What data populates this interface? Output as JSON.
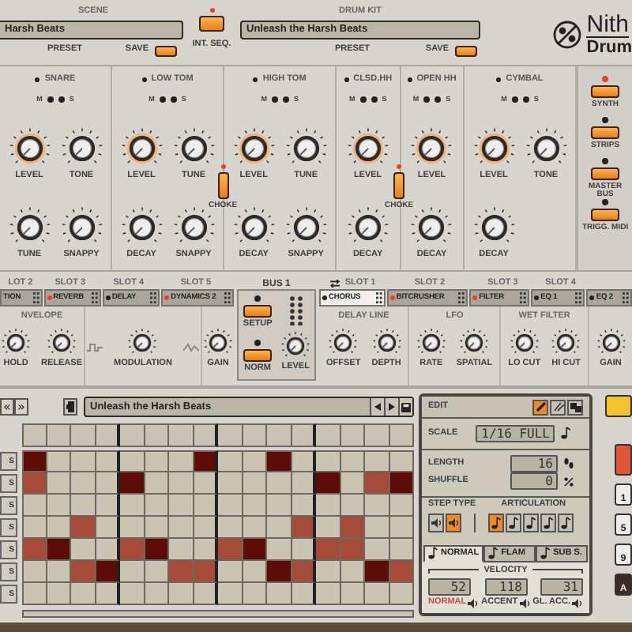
{
  "header": {
    "scene": {
      "label": "SCENE",
      "value": "Harsh Beats",
      "preset": "PRESET",
      "save": "SAVE"
    },
    "int_seq": {
      "label": "INT. SEQ.",
      "on": true
    },
    "drum_kit": {
      "label": "DRUM KIT",
      "value": "Unleash the Harsh Beats",
      "preset": "PRESET",
      "save": "SAVE"
    },
    "logo": {
      "title": "Nith",
      "subtitle": "Drum"
    }
  },
  "channels": [
    {
      "name": "SNARE",
      "mute": "M",
      "solo": "S",
      "knobs": [
        {
          "label": "LEVEL",
          "ring": true
        },
        {
          "label": "TONE",
          "ring": false
        },
        {
          "label": "TUNE",
          "ring": false
        },
        {
          "label": "SNAPPY",
          "ring": false
        }
      ]
    },
    {
      "name": "LOW TOM",
      "mute": "M",
      "solo": "S",
      "knobs": [
        {
          "label": "LEVEL",
          "ring": true
        },
        {
          "label": "TUNE",
          "ring": false
        },
        {
          "label": "DECAY",
          "ring": false
        },
        {
          "label": "SNAPPY",
          "ring": false
        }
      ],
      "choke": {
        "label": "CHOKE",
        "on": true
      }
    },
    {
      "name": "HIGH TOM",
      "mute": "M",
      "solo": "S",
      "knobs": [
        {
          "label": "LEVEL",
          "ring": true
        },
        {
          "label": "TUNE",
          "ring": false
        },
        {
          "label": "DECAY",
          "ring": false
        },
        {
          "label": "SNAPPY",
          "ring": false
        }
      ]
    },
    {
      "name": "CLSD.HH",
      "mute": "M",
      "solo": "S",
      "knobs": [
        {
          "label": "LEVEL",
          "ring": true
        },
        {
          "label": "DECAY",
          "ring": false
        }
      ],
      "choke": {
        "label": "CHOKE",
        "on": true
      }
    },
    {
      "name": "OPEN HH",
      "mute": "M",
      "solo": "S",
      "knobs": [
        {
          "label": "LEVEL",
          "ring": true
        },
        {
          "label": "DECAY",
          "ring": false
        }
      ]
    },
    {
      "name": "CYMBAL",
      "mute": "M",
      "solo": "S",
      "knobs": [
        {
          "label": "LEVEL",
          "ring": true
        },
        {
          "label": "TONE",
          "ring": false
        },
        {
          "label": "DECAY",
          "ring": false
        }
      ]
    }
  ],
  "mixer_buttons": [
    {
      "label": "SYNTH",
      "on": true
    },
    {
      "label": "STRIPS",
      "on": false
    },
    {
      "label": "MASTER BUS",
      "on": false
    },
    {
      "label": "TRIGG. MIDI",
      "on": false
    }
  ],
  "fx_left": {
    "slots": [
      "LOT 2",
      "SLOT 3",
      "SLOT 4",
      "SLOT 5"
    ],
    "tabs": [
      {
        "label": "TION",
        "selected": false
      },
      {
        "label": "REVERB",
        "on": true,
        "selected": false
      },
      {
        "label": "DELAY",
        "on": false,
        "selected": false
      },
      {
        "label": "DYNAMICS 2",
        "on": true,
        "selected": false
      }
    ],
    "sections": [
      {
        "title": "NVELOPE",
        "knobs": [
          "HOLD",
          "RELEASE"
        ]
      },
      {
        "kind": "modulation",
        "knobs": [
          "MODULATION"
        ]
      },
      {
        "knobs": [
          "GAIN"
        ]
      }
    ]
  },
  "bus": {
    "title": "BUS 1",
    "setup": "SETUP",
    "norm": "NORM",
    "knob": "LEVEL"
  },
  "fx_right": {
    "slots": [
      "SLOT 1",
      "SLOT 2",
      "SLOT 3",
      "SLOT 4"
    ],
    "tabs": [
      {
        "label": "CHORUS",
        "on": false,
        "selected": true
      },
      {
        "label": "BITCRUSHER",
        "on": true,
        "selected": false
      },
      {
        "label": "FILTER",
        "on": true,
        "selected": false
      },
      {
        "label": "EQ 1",
        "on": false,
        "selected": false
      },
      {
        "label": "EQ 2",
        "on": false,
        "selected": false
      }
    ],
    "sections": [
      {
        "title": "DELAY LINE",
        "knobs": [
          "OFFSET",
          "DEPTH"
        ]
      },
      {
        "title": "LFO",
        "knobs": [
          "RATE",
          "SPATIAL"
        ]
      },
      {
        "title": "WET FILTER",
        "knobs": [
          "LO CUT",
          "HI CUT"
        ]
      },
      {
        "knobs": [
          "GAIN"
        ]
      }
    ]
  },
  "sequencer": {
    "nav": [
      "«",
      "»"
    ],
    "pattern": "Unleash the Harsh Beats",
    "rows": [
      {
        "label": "S",
        "steps": [
          {
            "on": true,
            "accent": true
          },
          {
            "on": false
          },
          {
            "on": false
          },
          {
            "on": false
          },
          {
            "on": false
          },
          {
            "on": false
          },
          {
            "on": false
          },
          {
            "on": true,
            "accent": true
          },
          {
            "on": false
          },
          {
            "on": false
          },
          {
            "on": true,
            "accent": true
          },
          {
            "on": false
          },
          {
            "on": false
          },
          {
            "on": false
          },
          {
            "on": false
          },
          {
            "on": false
          }
        ]
      },
      {
        "label": "S",
        "steps": [
          {
            "on": true,
            "accent": false
          },
          {
            "on": false
          },
          {
            "on": false
          },
          {
            "on": false
          },
          {
            "on": true,
            "accent": true
          },
          {
            "on": false
          },
          {
            "on": false
          },
          {
            "on": false
          },
          {
            "on": false
          },
          {
            "on": false
          },
          {
            "on": false
          },
          {
            "on": false
          },
          {
            "on": true,
            "accent": true
          },
          {
            "on": false
          },
          {
            "on": true,
            "accent": false
          },
          {
            "on": true,
            "accent": true
          }
        ]
      },
      {
        "label": "S",
        "steps": [
          {
            "on": false
          },
          {
            "on": false
          },
          {
            "on": false
          },
          {
            "on": false
          },
          {
            "on": false
          },
          {
            "on": false
          },
          {
            "on": false
          },
          {
            "on": false
          },
          {
            "on": false
          },
          {
            "on": false
          },
          {
            "on": false
          },
          {
            "on": false
          },
          {
            "on": false
          },
          {
            "on": false
          },
          {
            "on": false
          },
          {
            "on": false
          }
        ]
      },
      {
        "label": "S",
        "steps": [
          {
            "on": false
          },
          {
            "on": false
          },
          {
            "on": true,
            "accent": false
          },
          {
            "on": false
          },
          {
            "on": false
          },
          {
            "on": false
          },
          {
            "on": false
          },
          {
            "on": false
          },
          {
            "on": false
          },
          {
            "on": false
          },
          {
            "on": false
          },
          {
            "on": true,
            "accent": false
          },
          {
            "on": false
          },
          {
            "on": true,
            "accent": false
          },
          {
            "on": false
          },
          {
            "on": false
          }
        ]
      },
      {
        "label": "S",
        "steps": [
          {
            "on": true,
            "accent": false
          },
          {
            "on": true,
            "accent": true
          },
          {
            "on": false
          },
          {
            "on": false
          },
          {
            "on": true,
            "accent": false
          },
          {
            "on": true,
            "accent": true
          },
          {
            "on": false
          },
          {
            "on": false
          },
          {
            "on": true,
            "accent": false
          },
          {
            "on": true,
            "accent": true
          },
          {
            "on": false
          },
          {
            "on": false
          },
          {
            "on": true,
            "accent": false
          },
          {
            "on": true,
            "accent": false
          },
          {
            "on": false
          },
          {
            "on": false
          }
        ]
      },
      {
        "label": "S",
        "steps": [
          {
            "on": false
          },
          {
            "on": false
          },
          {
            "on": true,
            "accent": false
          },
          {
            "on": true,
            "accent": true
          },
          {
            "on": false
          },
          {
            "on": false
          },
          {
            "on": true,
            "accent": false
          },
          {
            "on": true,
            "accent": false
          },
          {
            "on": false
          },
          {
            "on": false
          },
          {
            "on": true,
            "accent": true
          },
          {
            "on": true,
            "accent": false
          },
          {
            "on": false
          },
          {
            "on": false
          },
          {
            "on": true,
            "accent": true
          },
          {
            "on": true,
            "accent": false
          }
        ]
      },
      {
        "label": "S",
        "steps": [
          {
            "on": false
          },
          {
            "on": false
          },
          {
            "on": false
          },
          {
            "on": false
          },
          {
            "on": false
          },
          {
            "on": false
          },
          {
            "on": false
          },
          {
            "on": false
          },
          {
            "on": false
          },
          {
            "on": false
          },
          {
            "on": false
          },
          {
            "on": false
          },
          {
            "on": false
          },
          {
            "on": false
          },
          {
            "on": false
          },
          {
            "on": false
          }
        ]
      }
    ]
  },
  "edit": {
    "title": "EDIT",
    "tools": [
      {
        "kind": "pencil",
        "selected": true
      },
      {
        "kind": "line",
        "selected": false
      },
      {
        "kind": "blocks",
        "selected": false
      }
    ],
    "scale": {
      "label": "SCALE",
      "value": "1/16 FULL"
    },
    "length": {
      "label": "LENGTH",
      "value": "16"
    },
    "shuffle": {
      "label": "SHUFFLE",
      "value": "0"
    },
    "step_type": {
      "label": "STEP TYPE",
      "options": [
        {
          "selected": false
        },
        {
          "selected": true
        }
      ]
    },
    "articulation": {
      "label": "ARTICULATION",
      "options": [
        {
          "selected": true
        },
        {
          "selected": false
        },
        {
          "selected": false
        },
        {
          "selected": false
        },
        {
          "selected": false
        }
      ]
    },
    "tabs": [
      {
        "label": "NORMAL",
        "selected": true
      },
      {
        "label": "FLAM",
        "selected": false
      },
      {
        "label": "SUB S.",
        "selected": false
      }
    ],
    "velocity": {
      "label": "VELOCITY",
      "values": [
        {
          "value": "52",
          "label": "NORMAL",
          "selected": true
        },
        {
          "value": "118",
          "label": "ACCENT",
          "selected": false
        },
        {
          "value": "31",
          "label": "GL. ACC.",
          "selected": false
        }
      ]
    }
  },
  "pads": [
    {
      "kind": "yellow"
    },
    {
      "kind": "red"
    },
    {
      "kind": "bank",
      "label": "1"
    },
    {
      "kind": "bank",
      "label": "5"
    },
    {
      "kind": "bank",
      "label": "9"
    },
    {
      "kind": "dark",
      "label": "A"
    }
  ]
}
